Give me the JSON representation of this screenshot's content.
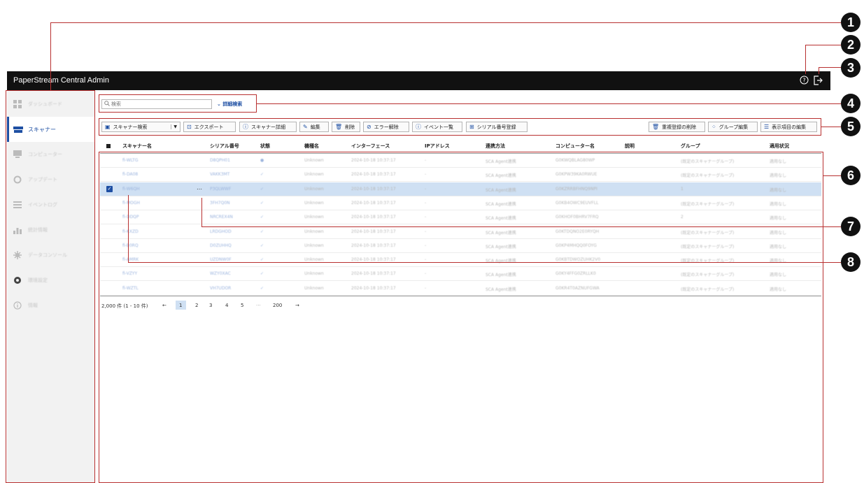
{
  "app_title": "PaperStream Central Admin",
  "header_icons": {
    "help": "help-icon",
    "logout": "logout-icon"
  },
  "sidebar": {
    "items": [
      {
        "label": "ダッシュボード",
        "icon": "dashboard-icon"
      },
      {
        "label": "スキャナー",
        "icon": "scanner-icon",
        "active": true
      },
      {
        "label": "コンピューター",
        "icon": "computer-icon"
      },
      {
        "label": "アップデート",
        "icon": "update-icon"
      },
      {
        "label": "イベントログ",
        "icon": "event-log-icon"
      },
      {
        "label": "統計情報",
        "icon": "statistics-icon"
      },
      {
        "label": "データコンソール",
        "icon": "data-console-icon"
      },
      {
        "label": "環境設定",
        "icon": "settings-icon"
      },
      {
        "label": "情報",
        "icon": "info-icon"
      }
    ]
  },
  "search": {
    "placeholder": "検索",
    "advanced_label": "詳細検索"
  },
  "toolbar": {
    "scanner_search": "スキャナー検索",
    "export": "エクスポート",
    "scanner_detail": "スキャナー詳細",
    "edit": "編集",
    "delete": "削除",
    "error_clear": "エラー解除",
    "event_list": "イベント一覧",
    "serial_register": "シリアル番号登録",
    "duplicate_delete": "重複登録の削除",
    "group_edit": "グループ編集",
    "display_items_edit": "表示項目の編集"
  },
  "table": {
    "columns": [
      "スキャナー名",
      "シリアル番号",
      "状態",
      "機種名",
      "インターフェース",
      "IPアドレス",
      "連携方法",
      "コンピューター名",
      "説明",
      "グループ",
      "適用状況"
    ],
    "rows": [
      [
        "fi-WLTG",
        "D8QPH01",
        "●",
        "Unknown",
        "2024-10-18 10:37:17",
        "-",
        "SCA Agent連携",
        "G0KWQBLAG80WP",
        "",
        "(既定のスキャナーグループ)",
        "適用なし"
      ],
      [
        "fi-DA08",
        "VAKK3MT",
        "✓",
        "Unknown",
        "2024-10-18 10:37:17",
        "-",
        "SCA Agent連携",
        "G0KPW39KA0RWUE",
        "",
        "(既定のスキャナーグループ)",
        "適用なし"
      ],
      [
        "fi-W6QH",
        "P3QLWWF",
        "✓",
        "Unknown",
        "2024-10-18 10:37:17",
        "-",
        "SCA Agent連携",
        "G0KZRRBFHNQ9NPI",
        "",
        "1",
        "適用なし"
      ],
      [
        "fi-MOGH",
        "3FH7Q0N",
        "✓",
        "Unknown",
        "2024-10-18 10:37:17",
        "-",
        "SCA Agent連携",
        "G0KB4OWC9EUVFLL",
        "",
        "(既定のスキャナーグループ)",
        "適用なし"
      ],
      [
        "fi-DDQP",
        "NRCREX4N",
        "✓",
        "Unknown",
        "2024-10-18 10:37:17",
        "-",
        "SCA Agent連携",
        "G0KHOF0BHRV7FRQ",
        "",
        "2",
        "適用なし"
      ],
      [
        "fi-KXZD",
        "LRDGHOD",
        "✓",
        "Unknown",
        "2024-10-18 10:37:17",
        "-",
        "SCA Agent連携",
        "G0KTDQNO2E0RYQH",
        "",
        "(既定のスキャナーグループ)",
        "適用なし"
      ],
      [
        "fi-B0RQ",
        "D0ZUHHQ",
        "✓",
        "Unknown",
        "2024-10-18 10:37:17",
        "-",
        "SCA Agent連携",
        "G0KP4MHQQ0FOYG",
        "",
        "(既定のスキャナーグループ)",
        "適用なし"
      ],
      [
        "fi-AMRK",
        "UZDNW0F",
        "✓",
        "Unknown",
        "2024-10-18 10:37:17",
        "-",
        "SCA Agent連携",
        "G0KBTDWOZUHK2V0",
        "",
        "(既定のスキャナーグループ)",
        "適用なし"
      ],
      [
        "fi-VZYY",
        "WZY0XAC",
        "✓",
        "Unknown",
        "2024-10-18 10:37:17",
        "-",
        "SCA Agent連携",
        "G0KY4FFG0ZRLLK0",
        "",
        "(既定のスキャナーグループ)",
        "適用なし"
      ],
      [
        "fi-WZTL",
        "VH7UDOR",
        "✓",
        "Unknown",
        "2024-10-18 10:37:17",
        "-",
        "SCA Agent連携",
        "G0KR4T0AZNUFGWA",
        "",
        "(既定のスキャナーグループ)",
        "適用なし"
      ]
    ]
  },
  "pagination": {
    "summary": "2,000 件 (1 - 10 件)",
    "prev": "←",
    "pages": [
      "1",
      "2",
      "3",
      "4",
      "5"
    ],
    "ellipsis": "···",
    "last": "200",
    "next": "→",
    "current": "1"
  },
  "callouts": [
    "1",
    "2",
    "3",
    "4",
    "5",
    "6",
    "7",
    "8"
  ],
  "colors": {
    "accent": "#1e4fa3",
    "titlebar": "#111111",
    "callout": "#b83030",
    "selected_row": "#cfe0f3"
  }
}
